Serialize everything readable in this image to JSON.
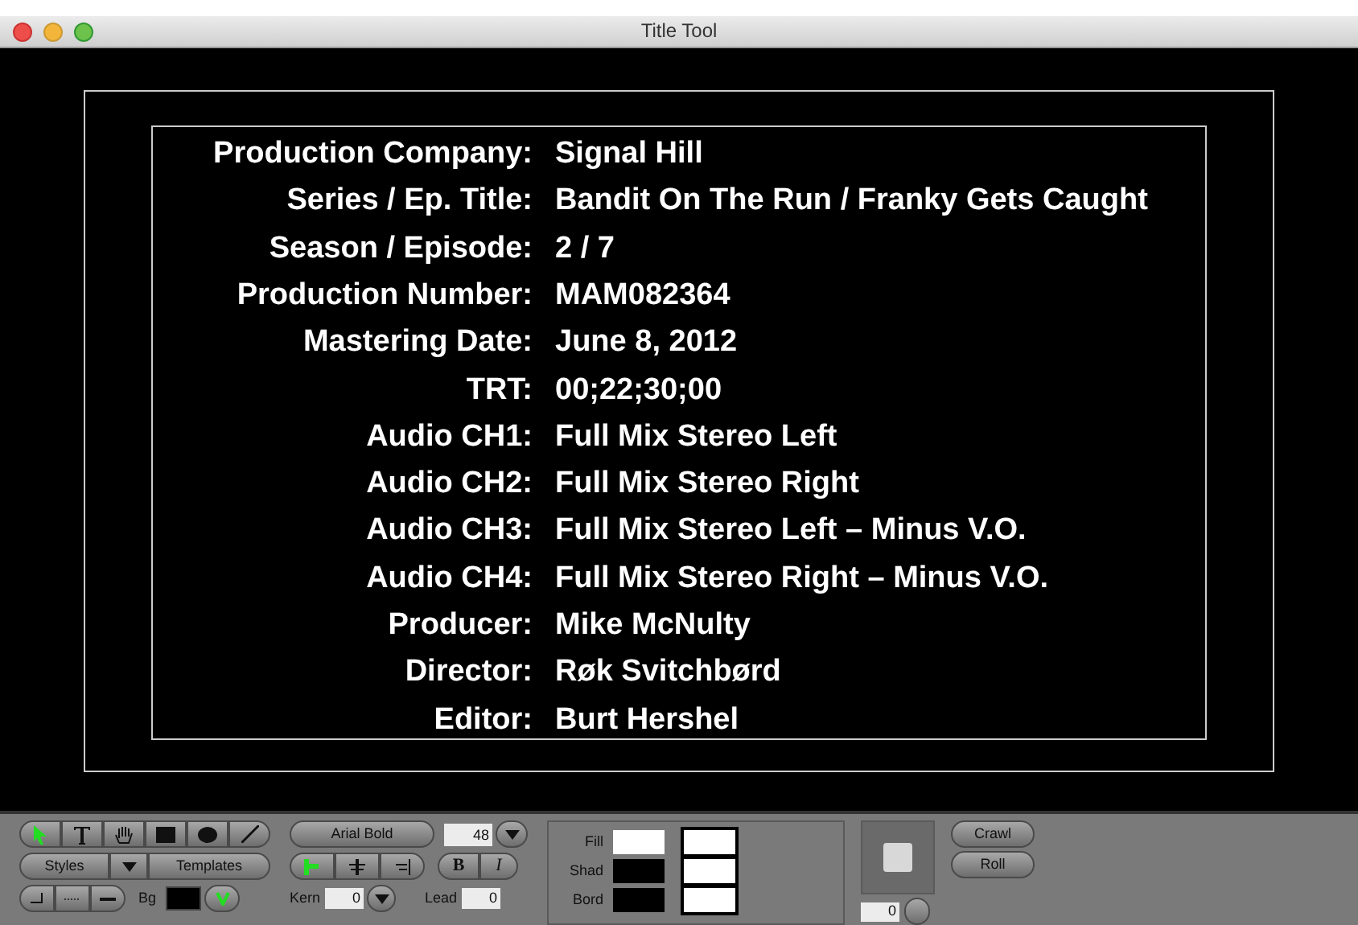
{
  "window": {
    "title": "Title Tool"
  },
  "slate": [
    {
      "label": "Production Company:",
      "value": "Signal Hill"
    },
    {
      "label": "Series / Ep. Title:",
      "value": "Bandit On The Run / Franky Gets Caught"
    },
    {
      "label": "Season / Episode:",
      "value": "2 / 7"
    },
    {
      "label": "Production Number:",
      "value": "MAM082364"
    },
    {
      "label": "Mastering Date:",
      "value": "June 8, 2012"
    },
    {
      "label": "TRT:",
      "value": "00;22;30;00"
    },
    {
      "label": "Audio CH1:",
      "value": "Full Mix Stereo Left"
    },
    {
      "label": "Audio CH2:",
      "value": "Full Mix Stereo Right"
    },
    {
      "label": "Audio CH3:",
      "value": "Full Mix Stereo Left – Minus V.O."
    },
    {
      "label": "Audio CH4:",
      "value": "Full Mix Stereo Right – Minus V.O."
    },
    {
      "label": "Producer:",
      "value": "Mike McNulty"
    },
    {
      "label": "Director:",
      "value": "Røk Svitchbørd"
    },
    {
      "label": "Editor:",
      "value": "Burt Hershel"
    }
  ],
  "toolbar": {
    "tools": [
      {
        "kind": "arrow",
        "selected": true
      },
      {
        "kind": "text",
        "selected": false
      },
      {
        "kind": "hand",
        "selected": false
      },
      {
        "kind": "rect",
        "selected": false
      },
      {
        "kind": "ellipse",
        "selected": false
      },
      {
        "kind": "line",
        "selected": false
      }
    ],
    "styles_button": "Styles",
    "templates_button": "Templates",
    "font": "Arial Bold",
    "size": "48",
    "alignment": [
      {
        "kind": "left",
        "selected": true
      },
      {
        "kind": "center",
        "selected": false
      },
      {
        "kind": "right",
        "selected": false
      }
    ],
    "bold_button": "B",
    "italic_button": "I",
    "bg": {
      "label": "Bg",
      "color": "#000000",
      "visible": true
    },
    "kern_label": "Kern",
    "kern": "0",
    "lead_label": "Lead",
    "lead": "0",
    "colors": [
      {
        "label": "Fill",
        "swatches": [
          {
            "color": "#ffffff"
          },
          {
            "color": "#ffffff"
          }
        ]
      },
      {
        "label": "Shad",
        "swatches": [
          {
            "color": "#000000"
          },
          {
            "color": "#ffffff"
          }
        ]
      },
      {
        "label": "Bord",
        "swatches": [
          {
            "color": "#000000"
          },
          {
            "color": "#ffffff"
          }
        ]
      }
    ],
    "opacity": "0",
    "crawl_button": "Crawl",
    "roll_button": "Roll"
  }
}
